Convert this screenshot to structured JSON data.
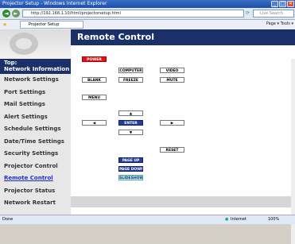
{
  "window": {
    "title": "Projector Setup - Windows Internet Explorer"
  },
  "browser": {
    "address": "http://192.168.1.10/html/projectorsetup.html",
    "search_placeholder": "Live Search",
    "tab_label": "Projector Setup",
    "commands": "Page ▾   Tools ▾"
  },
  "sidebar": {
    "top_label_line1": "Top:",
    "top_label_line2": "Network Information",
    "items": [
      {
        "label": "Network Settings"
      },
      {
        "label": "Port Settings"
      },
      {
        "label": "Mail Settings"
      },
      {
        "label": "Alert Settings"
      },
      {
        "label": "Schedule Settings"
      },
      {
        "label": "Date/Time Settings"
      },
      {
        "label": "Security Settings"
      },
      {
        "label": "Projector Control"
      },
      {
        "label": "Remote Control"
      },
      {
        "label": "Projector Status"
      },
      {
        "label": "Network Restart"
      }
    ]
  },
  "page": {
    "title": "Remote Control"
  },
  "remote": {
    "power": "POWER",
    "computer": "COMPUTER",
    "video": "VIDEO",
    "blank": "BLANK",
    "freeze": "FREEZE",
    "mute": "MUTE",
    "menu": "MENU",
    "up": "▲",
    "left": "◀",
    "enter": "ENTER",
    "right": "▶",
    "down": "▼",
    "reset": "RESET",
    "page_up": "PAGE UP",
    "page_down": "PAGE DOWN",
    "slideshow": "SLIDESHOW"
  },
  "status": {
    "left": "Done",
    "zone": "Internet",
    "zoom": "100%"
  },
  "colors": {
    "nav_blue": "#1b2f68",
    "power_red": "#e2111c",
    "active_link": "#1b2fd0"
  }
}
